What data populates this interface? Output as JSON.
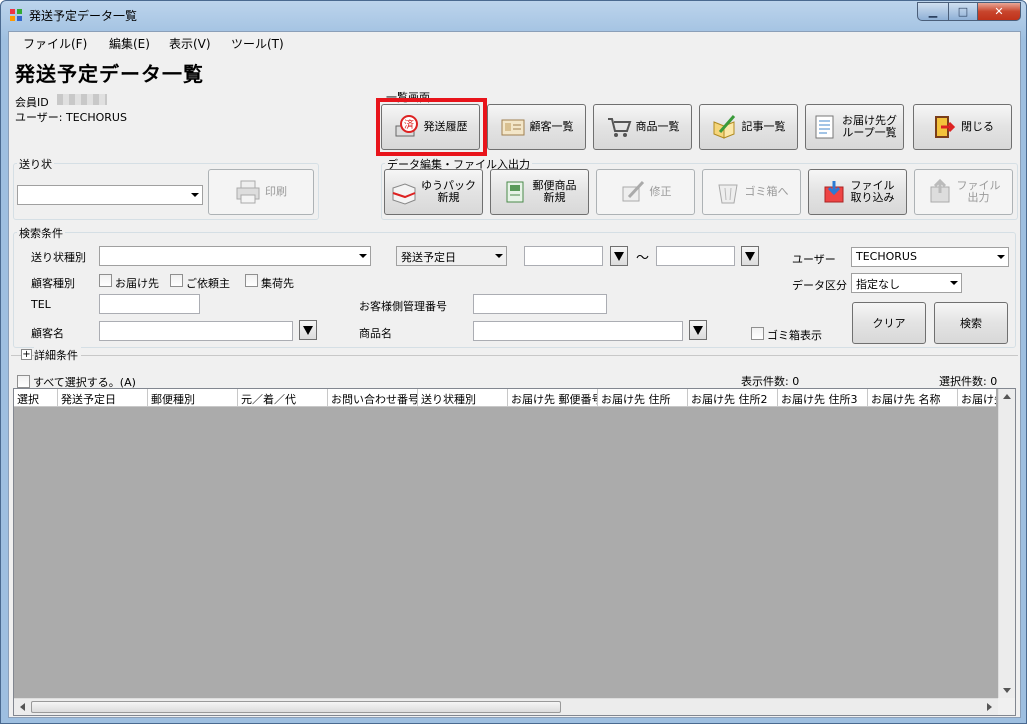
{
  "window": {
    "title": "発送予定データ一覧",
    "minimize": "▁",
    "maximize": "□",
    "close": "✕"
  },
  "menu": [
    "ファイル(F)",
    "編集(E)",
    "表示(V)",
    "ツール(T)"
  ],
  "page_title": "発送予定データ一覧",
  "member": {
    "id_label": "会員ID",
    "user_label": "ユーザー: TECHORUS"
  },
  "list_screen": {
    "caption": "一覧画面",
    "buttons": [
      "発送履歴",
      "顧客一覧",
      "商品一覧",
      "記事一覧",
      "お届け先グ\nループ一覧",
      "閉じる"
    ]
  },
  "slip": {
    "caption": "送り状",
    "print_button": "印刷"
  },
  "data_edit": {
    "caption": "データ編集・ファイル入出力",
    "buttons": [
      "ゆうパック\n新規",
      "郵便商品\n新規",
      "修正",
      "ゴミ箱へ",
      "ファイル\n取り込み",
      "ファイル\n出力"
    ]
  },
  "search": {
    "caption": "検索条件",
    "slip_type_label": "送り状種別",
    "date_type": "発送予定日",
    "tilde": "～",
    "user_label": "ユーザー",
    "user_value": "TECHORUS",
    "data_class_label": "データ区分",
    "data_class_value": "指定なし",
    "customer_type_label": "顧客種別",
    "chk_delivery": "お届け先",
    "chk_client": "ご依頼主",
    "chk_pickup": "集荷先",
    "tel_label": "TEL",
    "mgmt_label": "お客様側管理番号",
    "customer_name_label": "顧客名",
    "product_label": "商品名",
    "trash_label": "ゴミ箱表示",
    "clear_button": "クリア",
    "search_button": "検索"
  },
  "details": {
    "label": "詳細条件"
  },
  "list": {
    "select_all": "すべて選択する。(A)",
    "display_count": "表示件数: 0",
    "selected_count": "選択件数: 0",
    "columns": [
      "選択",
      "発送予定日",
      "郵便種別",
      "元／着／代",
      "お問い合わせ番号",
      "送り状種別",
      "お届け先 郵便番号",
      "お届け先 住所",
      "お届け先 住所2",
      "お届け先 住所3",
      "お届け先 名称",
      "お届け先"
    ]
  }
}
